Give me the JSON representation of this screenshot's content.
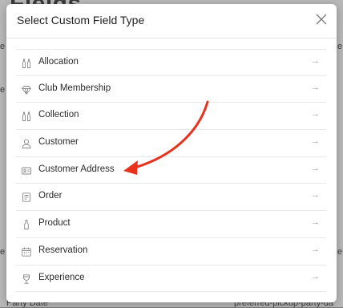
{
  "background": {
    "heading_fragment": "Fields",
    "left_fragments": [
      "e",
      "e",
      "e"
    ],
    "right_fragments": [
      "e",
      "e"
    ],
    "bottom_left": "Party Date",
    "bottom_right": "preferred-pickup-party-da"
  },
  "modal": {
    "title": "Select Custom Field Type",
    "close_icon": "close-icon",
    "items": [
      {
        "label": "Allocation",
        "icon": "bottles-icon",
        "arrow": "→"
      },
      {
        "label": "Club Membership",
        "icon": "diamond-icon",
        "arrow": "→"
      },
      {
        "label": "Collection",
        "icon": "bottles-icon",
        "arrow": "→"
      },
      {
        "label": "Customer",
        "icon": "user-icon",
        "arrow": "→"
      },
      {
        "label": "Customer Address",
        "icon": "address-card-icon",
        "arrow": "→"
      },
      {
        "label": "Order",
        "icon": "receipt-icon",
        "arrow": "→"
      },
      {
        "label": "Product",
        "icon": "bottle-icon",
        "arrow": "→"
      },
      {
        "label": "Reservation",
        "icon": "calendar-icon",
        "arrow": "→"
      },
      {
        "label": "Experience",
        "icon": "wine-glass-icon",
        "arrow": "→"
      }
    ]
  },
  "annotation": {
    "color": "#e8321e",
    "points_to": "Customer Address"
  }
}
